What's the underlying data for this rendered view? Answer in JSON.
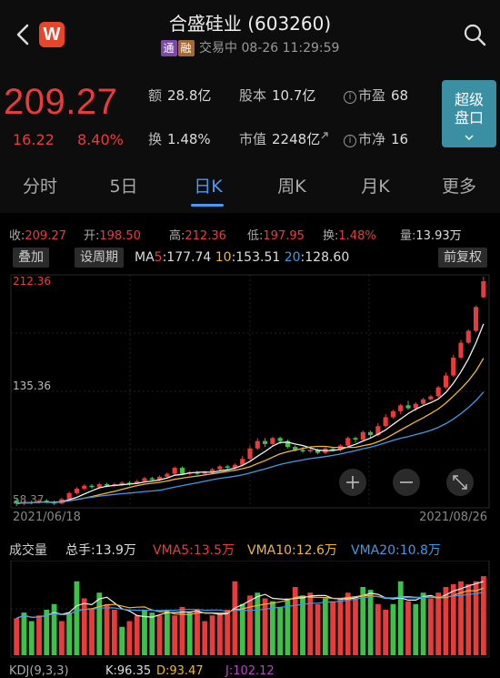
{
  "header": {
    "logo_text": "W",
    "title": "合盛硅业 (603260)",
    "tag_tong": "通",
    "tag_rong": "融",
    "status": "交易中",
    "datetime": "08-26 11:29:59"
  },
  "quote": {
    "price": "209.27",
    "change": "16.22",
    "change_pct": "8.40%",
    "amount_label": "额",
    "amount": "28.8亿",
    "capital_label": "股本",
    "capital": "10.7亿",
    "pe_label": "市盈",
    "pe": "68",
    "turnover_label": "换",
    "turnover": "1.48%",
    "mktcap_label": "市值",
    "mktcap": "2248亿",
    "pb_label": "市净",
    "pb": "16",
    "super_line1": "超级",
    "super_line2": "盘口",
    "info_icon_text": "i"
  },
  "tabs": [
    "分时",
    "5日",
    "日K",
    "周K",
    "月K",
    "更多"
  ],
  "active_tab": 2,
  "stats": {
    "close_label": "收:",
    "close": "209.27",
    "open_label": "开:",
    "open": "198.50",
    "high_label": "高:",
    "high": "212.36",
    "low_label": "低:",
    "low": "197.95",
    "turn_label": "换:",
    "turn": "1.48%",
    "vol_label": "量:",
    "vol": "13.93万"
  },
  "ma": {
    "overlay_btn": "叠加",
    "period_btn": "设周期",
    "ma_prefix": "MA",
    "ma5_key": "5",
    "ma5": ":177.74",
    "ma10_key": "10",
    "ma10": ":153.51",
    "ma20_key": "20",
    "ma20": ":128.60",
    "adjust_btn": "前复权"
  },
  "chart_labels": {
    "high_price": "212.36",
    "mid_price": "135.36",
    "low_price": "58.37",
    "start_date": "2021/06/18",
    "end_date": "2021/08/26"
  },
  "volume": {
    "title": "成交量",
    "total": "总手:13.9万",
    "vma5": "VMA5:13.5万",
    "vma10": "VMA10:12.6万",
    "vma20": "VMA20:10.8万"
  },
  "kdj": {
    "label": "KDJ(9,3,3)",
    "k": "K:96.35",
    "d": "D:93.47",
    "j": "J:102.12"
  },
  "colors": {
    "up": "#e83c3c",
    "down": "#3cc24a",
    "ma5": "#f0f0f0",
    "ma10": "#f2b830",
    "ma20": "#3c9ae8",
    "accent": "#4a9bf0"
  },
  "chart_data": [
    {
      "type": "candlestick",
      "title": "日K",
      "x_range": [
        "2021/06/18",
        "2021/08/26"
      ],
      "ylim": [
        58.37,
        212.36
      ],
      "y_ticks": [
        212.36,
        135.36,
        58.37
      ],
      "series": [
        {
          "name": "MA5",
          "last": 177.74
        },
        {
          "name": "MA10",
          "last": 153.51
        },
        {
          "name": "MA20",
          "last": 128.6
        }
      ],
      "candles": [
        {
          "o": 62,
          "c": 60,
          "h": 64,
          "l": 58.4,
          "up": false
        },
        {
          "o": 60,
          "c": 61,
          "h": 62,
          "l": 59,
          "up": true
        },
        {
          "o": 61,
          "c": 60.5,
          "h": 62,
          "l": 59.5,
          "up": false
        },
        {
          "o": 60.5,
          "c": 62,
          "h": 63,
          "l": 60,
          "up": true
        },
        {
          "o": 62,
          "c": 61,
          "h": 63,
          "l": 60,
          "up": false
        },
        {
          "o": 61,
          "c": 60,
          "h": 62,
          "l": 59,
          "up": false
        },
        {
          "o": 60,
          "c": 63,
          "h": 64,
          "l": 59.5,
          "up": true
        },
        {
          "o": 63,
          "c": 67,
          "h": 68,
          "l": 62,
          "up": true
        },
        {
          "o": 67,
          "c": 70,
          "h": 71,
          "l": 66,
          "up": true
        },
        {
          "o": 70,
          "c": 72,
          "h": 73,
          "l": 69,
          "up": true
        },
        {
          "o": 72,
          "c": 71,
          "h": 73,
          "l": 70,
          "up": false
        },
        {
          "o": 71,
          "c": 73,
          "h": 74,
          "l": 70,
          "up": true
        },
        {
          "o": 73,
          "c": 72,
          "h": 74,
          "l": 71,
          "up": false
        },
        {
          "o": 72,
          "c": 73,
          "h": 74,
          "l": 71,
          "up": true
        },
        {
          "o": 73,
          "c": 74,
          "h": 75,
          "l": 72,
          "up": true
        },
        {
          "o": 74,
          "c": 73.5,
          "h": 75,
          "l": 72,
          "up": false
        },
        {
          "o": 73.5,
          "c": 75,
          "h": 76,
          "l": 73,
          "up": true
        },
        {
          "o": 75,
          "c": 77,
          "h": 78,
          "l": 74,
          "up": true
        },
        {
          "o": 77,
          "c": 76,
          "h": 78,
          "l": 75,
          "up": false
        },
        {
          "o": 76,
          "c": 78,
          "h": 79,
          "l": 75,
          "up": true
        },
        {
          "o": 78,
          "c": 80,
          "h": 81,
          "l": 77,
          "up": true
        },
        {
          "o": 80,
          "c": 84,
          "h": 85,
          "l": 79,
          "up": true
        },
        {
          "o": 84,
          "c": 80,
          "h": 85,
          "l": 79,
          "up": false
        },
        {
          "o": 80,
          "c": 81,
          "h": 82,
          "l": 79,
          "up": true
        },
        {
          "o": 81,
          "c": 80,
          "h": 82,
          "l": 79,
          "up": false
        },
        {
          "o": 80,
          "c": 81,
          "h": 82,
          "l": 79,
          "up": true
        },
        {
          "o": 81,
          "c": 83,
          "h": 84,
          "l": 80,
          "up": true
        },
        {
          "o": 83,
          "c": 85,
          "h": 86,
          "l": 82,
          "up": true
        },
        {
          "o": 85,
          "c": 84,
          "h": 86,
          "l": 83,
          "up": false
        },
        {
          "o": 84,
          "c": 86,
          "h": 87,
          "l": 83,
          "up": true
        },
        {
          "o": 86,
          "c": 90,
          "h": 92,
          "l": 85,
          "up": true
        },
        {
          "o": 90,
          "c": 97,
          "h": 99,
          "l": 89,
          "up": true
        },
        {
          "o": 97,
          "c": 102,
          "h": 104,
          "l": 96,
          "up": true
        },
        {
          "o": 102,
          "c": 100,
          "h": 104,
          "l": 98,
          "up": false
        },
        {
          "o": 100,
          "c": 104,
          "h": 105,
          "l": 99,
          "up": true
        },
        {
          "o": 104,
          "c": 102,
          "h": 105,
          "l": 100,
          "up": false
        },
        {
          "o": 102,
          "c": 98,
          "h": 103,
          "l": 97,
          "up": false
        },
        {
          "o": 98,
          "c": 96,
          "h": 99,
          "l": 95,
          "up": false
        },
        {
          "o": 96,
          "c": 95,
          "h": 98,
          "l": 94,
          "up": false
        },
        {
          "o": 95,
          "c": 96,
          "h": 97,
          "l": 94,
          "up": true
        },
        {
          "o": 96,
          "c": 94,
          "h": 97,
          "l": 93,
          "up": false
        },
        {
          "o": 94,
          "c": 97,
          "h": 98,
          "l": 93,
          "up": true
        },
        {
          "o": 97,
          "c": 96,
          "h": 98,
          "l": 95,
          "up": false
        },
        {
          "o": 96,
          "c": 99,
          "h": 100,
          "l": 95,
          "up": true
        },
        {
          "o": 99,
          "c": 104,
          "h": 105,
          "l": 98,
          "up": true
        },
        {
          "o": 104,
          "c": 103,
          "h": 105,
          "l": 101,
          "up": false
        },
        {
          "o": 103,
          "c": 108,
          "h": 109,
          "l": 102,
          "up": true
        },
        {
          "o": 108,
          "c": 106,
          "h": 109,
          "l": 104,
          "up": false
        },
        {
          "o": 106,
          "c": 112,
          "h": 114,
          "l": 105,
          "up": true
        },
        {
          "o": 112,
          "c": 118,
          "h": 120,
          "l": 111,
          "up": true
        },
        {
          "o": 118,
          "c": 122,
          "h": 123,
          "l": 117,
          "up": true
        },
        {
          "o": 122,
          "c": 126,
          "h": 127,
          "l": 120,
          "up": true
        },
        {
          "o": 126,
          "c": 124,
          "h": 129,
          "l": 123,
          "up": false
        },
        {
          "o": 124,
          "c": 127,
          "h": 128,
          "l": 122,
          "up": true
        },
        {
          "o": 127,
          "c": 130,
          "h": 131,
          "l": 126,
          "up": true
        },
        {
          "o": 130,
          "c": 132,
          "h": 133,
          "l": 129,
          "up": true
        },
        {
          "o": 132,
          "c": 138,
          "h": 139,
          "l": 131,
          "up": true
        },
        {
          "o": 138,
          "c": 146,
          "h": 148,
          "l": 137,
          "up": true
        },
        {
          "o": 146,
          "c": 158,
          "h": 160,
          "l": 145,
          "up": true
        },
        {
          "o": 158,
          "c": 168,
          "h": 170,
          "l": 157,
          "up": true
        },
        {
          "o": 168,
          "c": 176,
          "h": 177,
          "l": 167,
          "up": true
        },
        {
          "o": 176,
          "c": 192,
          "h": 193,
          "l": 175,
          "up": true
        },
        {
          "o": 198.5,
          "c": 209.27,
          "h": 212.36,
          "l": 197.95,
          "up": true
        }
      ]
    },
    {
      "type": "bar",
      "title": "成交量",
      "series": [
        {
          "name": "VMA5",
          "last": "13.5万"
        },
        {
          "name": "VMA10",
          "last": "12.6万"
        },
        {
          "name": "VMA20",
          "last": "10.8万"
        }
      ],
      "values_wan": [
        6.5,
        7.5,
        6,
        7,
        8,
        9,
        6,
        7.5,
        13,
        10,
        8,
        11,
        9,
        8,
        5,
        6,
        7,
        8,
        7.5,
        7,
        8,
        7,
        8.5,
        7.5,
        8,
        6,
        7,
        7.5,
        8,
        13,
        9,
        10.5,
        11,
        10,
        9.5,
        8.5,
        10,
        12,
        10.5,
        11,
        9,
        10,
        9.5,
        10,
        11,
        10,
        12,
        11.5,
        9,
        8,
        9,
        13,
        9.5,
        9,
        11,
        10,
        11,
        12,
        12.5,
        13,
        12.5,
        13,
        13.9
      ],
      "up": [
        true,
        false,
        false,
        true,
        false,
        false,
        true,
        false,
        false,
        true,
        true,
        false,
        true,
        true,
        false,
        true,
        true,
        false,
        false,
        true,
        false,
        true,
        true,
        false,
        true,
        true,
        true,
        true,
        true,
        true,
        false,
        true,
        false,
        true,
        false,
        false,
        false,
        true,
        false,
        true,
        true,
        false,
        true,
        true,
        true,
        true,
        false,
        false,
        true,
        true,
        false,
        false,
        true,
        false,
        false,
        true,
        true,
        true,
        true,
        true,
        true,
        true,
        true
      ]
    }
  ]
}
